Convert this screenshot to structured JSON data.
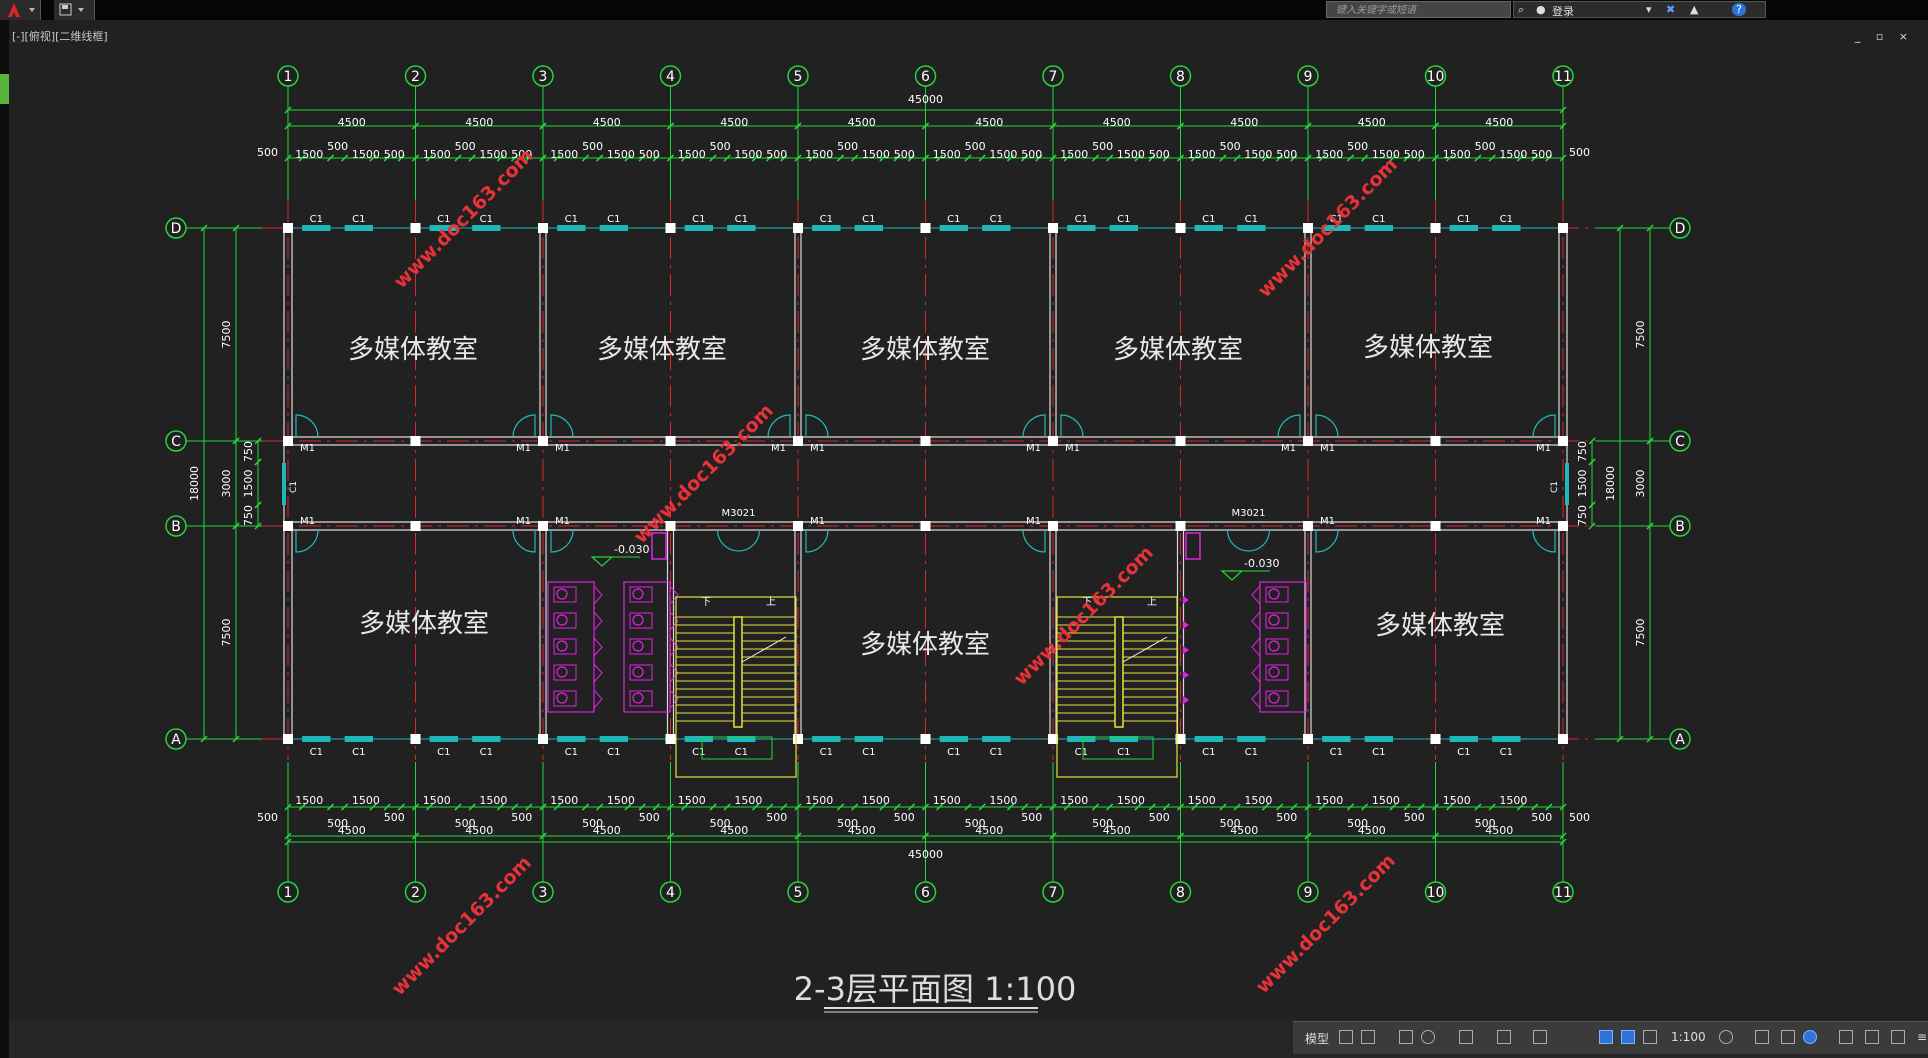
{
  "app": {
    "search_placeholder": "键入关键字或短语",
    "login_label": "登录",
    "viewport_label": "[-][俯视][二维线框]",
    "window_controls": "_ ▫ ×"
  },
  "drawing": {
    "title": "2-3层平面图 1:100",
    "axis_numbers": [
      "1",
      "2",
      "3",
      "4",
      "5",
      "6",
      "7",
      "8",
      "9",
      "10",
      "11"
    ],
    "axis_letters": [
      "D",
      "C",
      "B",
      "A"
    ],
    "dims": {
      "total": "45000",
      "bay": "4500",
      "wall_seg": "500",
      "window_seg": "1500",
      "room_depth": "7500",
      "corridor": "3000",
      "total_depth": "18000",
      "corridor_part_a": "750",
      "corridor_part_b": "1500"
    },
    "labels": {
      "window": "C1",
      "door": "M1",
      "double_door": "M3021",
      "room": "多媒体教室",
      "elevation": "-0.030",
      "stair_down": "下",
      "stair_up": "上"
    },
    "watermark": "www.doc163.com"
  },
  "statusbar": {
    "model_label": "模型",
    "scale_label": "1:100"
  },
  "colors": {
    "background": "#212121",
    "axis_green": "#22d63a",
    "center_red": "#e0242e",
    "wall": "#d9d9d9",
    "window_cyan": "#1fb7b7",
    "fixture_magenta": "#e223e2",
    "stair_yellow": "#e6e23a",
    "watermark_red": "#e8323a"
  }
}
